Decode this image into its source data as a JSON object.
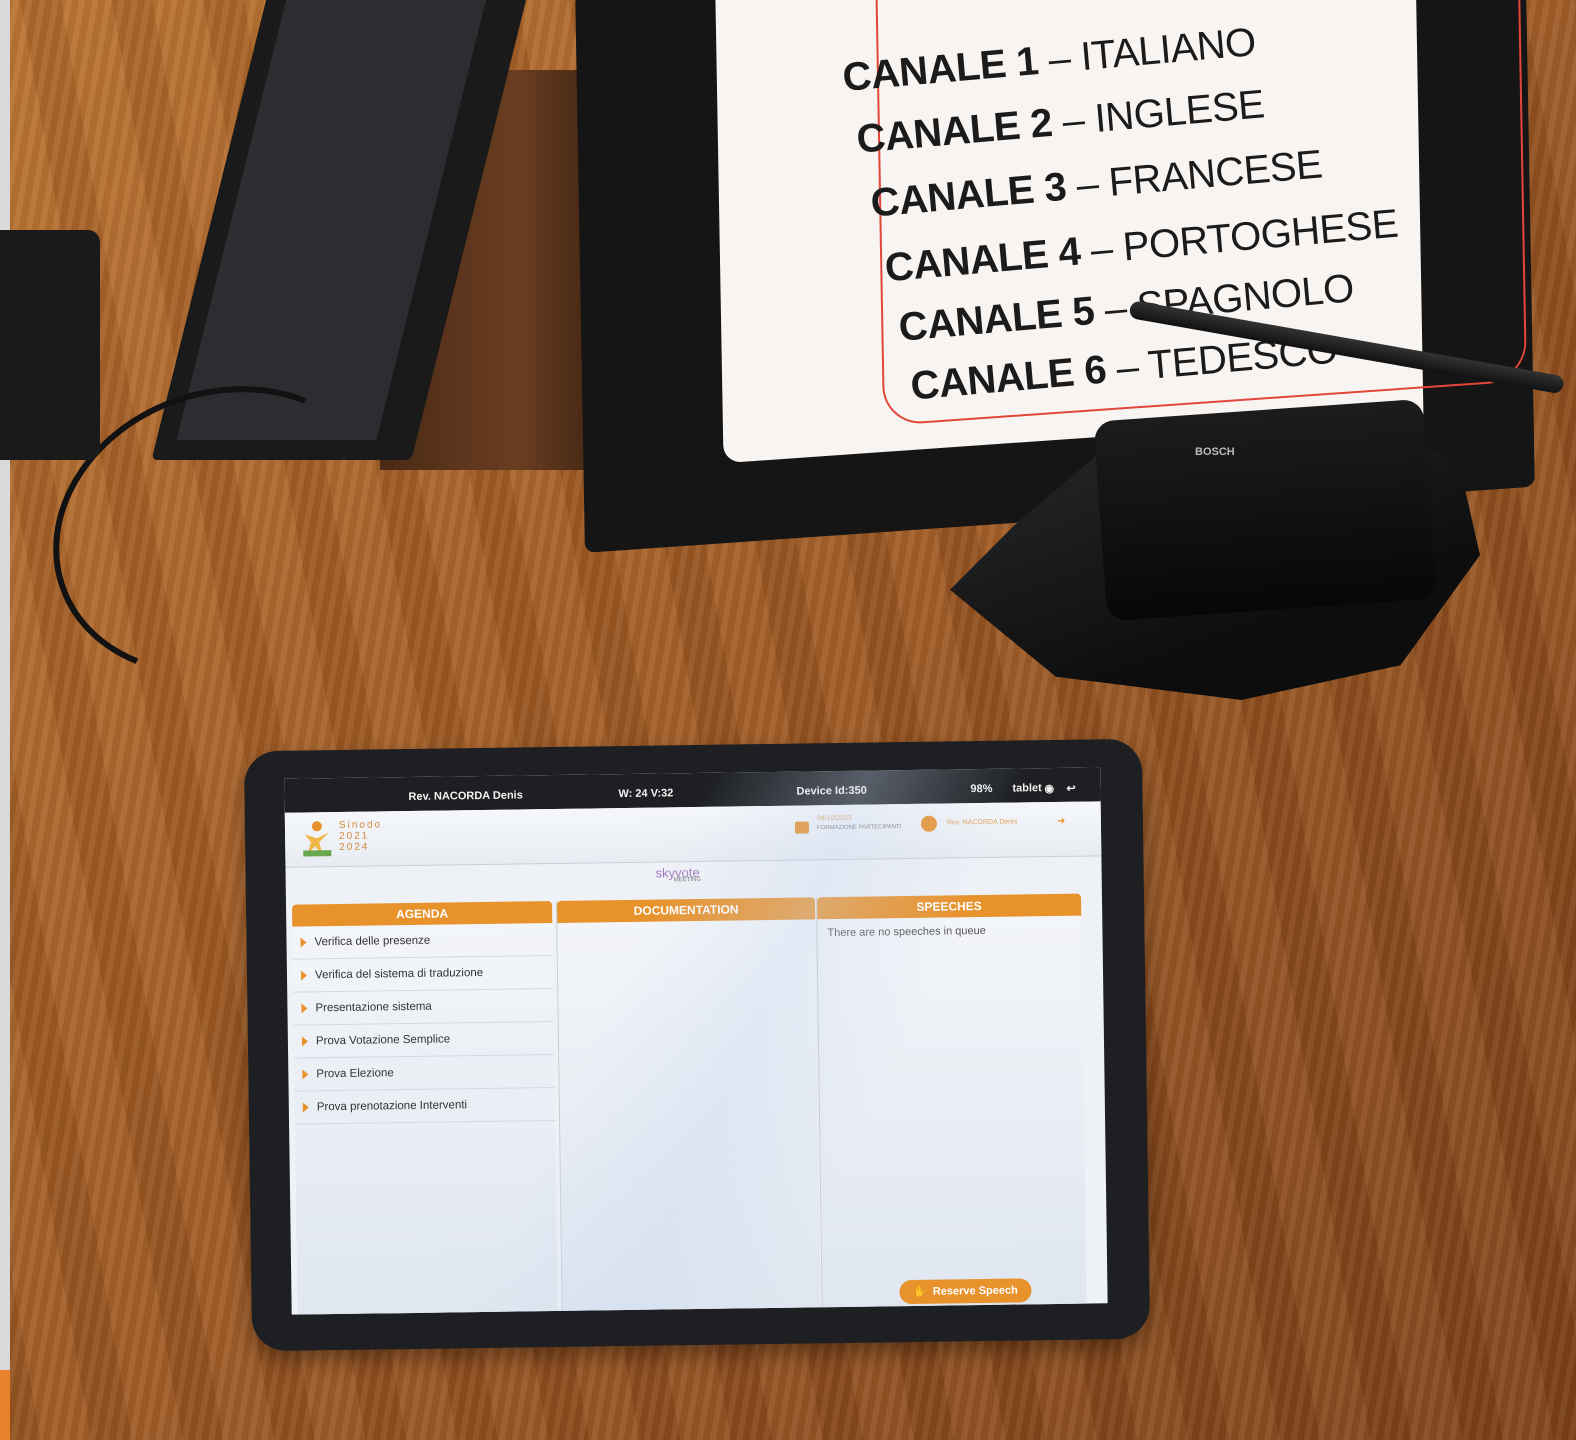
{
  "monitor": {
    "channels": [
      {
        "label": "CANALE 1",
        "language": "ITALIANO"
      },
      {
        "label": "CANALE 2",
        "language": "INGLESE"
      },
      {
        "label": "CANALE 3",
        "language": "FRANCESE"
      },
      {
        "label": "CANALE 4",
        "language": "PORTOGHESE"
      },
      {
        "label": "CANALE 5",
        "language": "SPAGNOLO"
      },
      {
        "label": "CANALE 6",
        "language": "TEDESCO"
      }
    ],
    "separator": " – "
  },
  "mic": {
    "brand": "BOSCH"
  },
  "statusbar": {
    "user": "Rev. NACORDA Denis",
    "counters": "W: 24   V:32",
    "device_id": "Device Id:350",
    "battery": "98%",
    "network": "tablet"
  },
  "appbar": {
    "logo_text": [
      "Sinodo",
      "2021",
      "2024"
    ],
    "meeting_date": "04/10/2023",
    "meeting_name": "FORMAZIONE PARTECIPANTI",
    "user_name": "Rev. NACORDA Denis"
  },
  "brand": {
    "name": "skyvote",
    "sub": "MEETING"
  },
  "columns": {
    "agenda": {
      "title": "AGENDA",
      "items": [
        "Verifica delle presenze",
        "Verifica del sistema di traduzione",
        "Presentazione sistema",
        "Prova Votazione Semplice",
        "Prova Elezione",
        "Prova prenotazione Interventi"
      ]
    },
    "documentation": {
      "title": "DOCUMENTATION"
    },
    "speeches": {
      "title": "SPEECHES",
      "empty_message": "There are no speeches in queue",
      "reserve_label": "Reserve Speech"
    }
  },
  "colors": {
    "accent": "#e8922c",
    "monitor_frame": "#e2463a"
  }
}
